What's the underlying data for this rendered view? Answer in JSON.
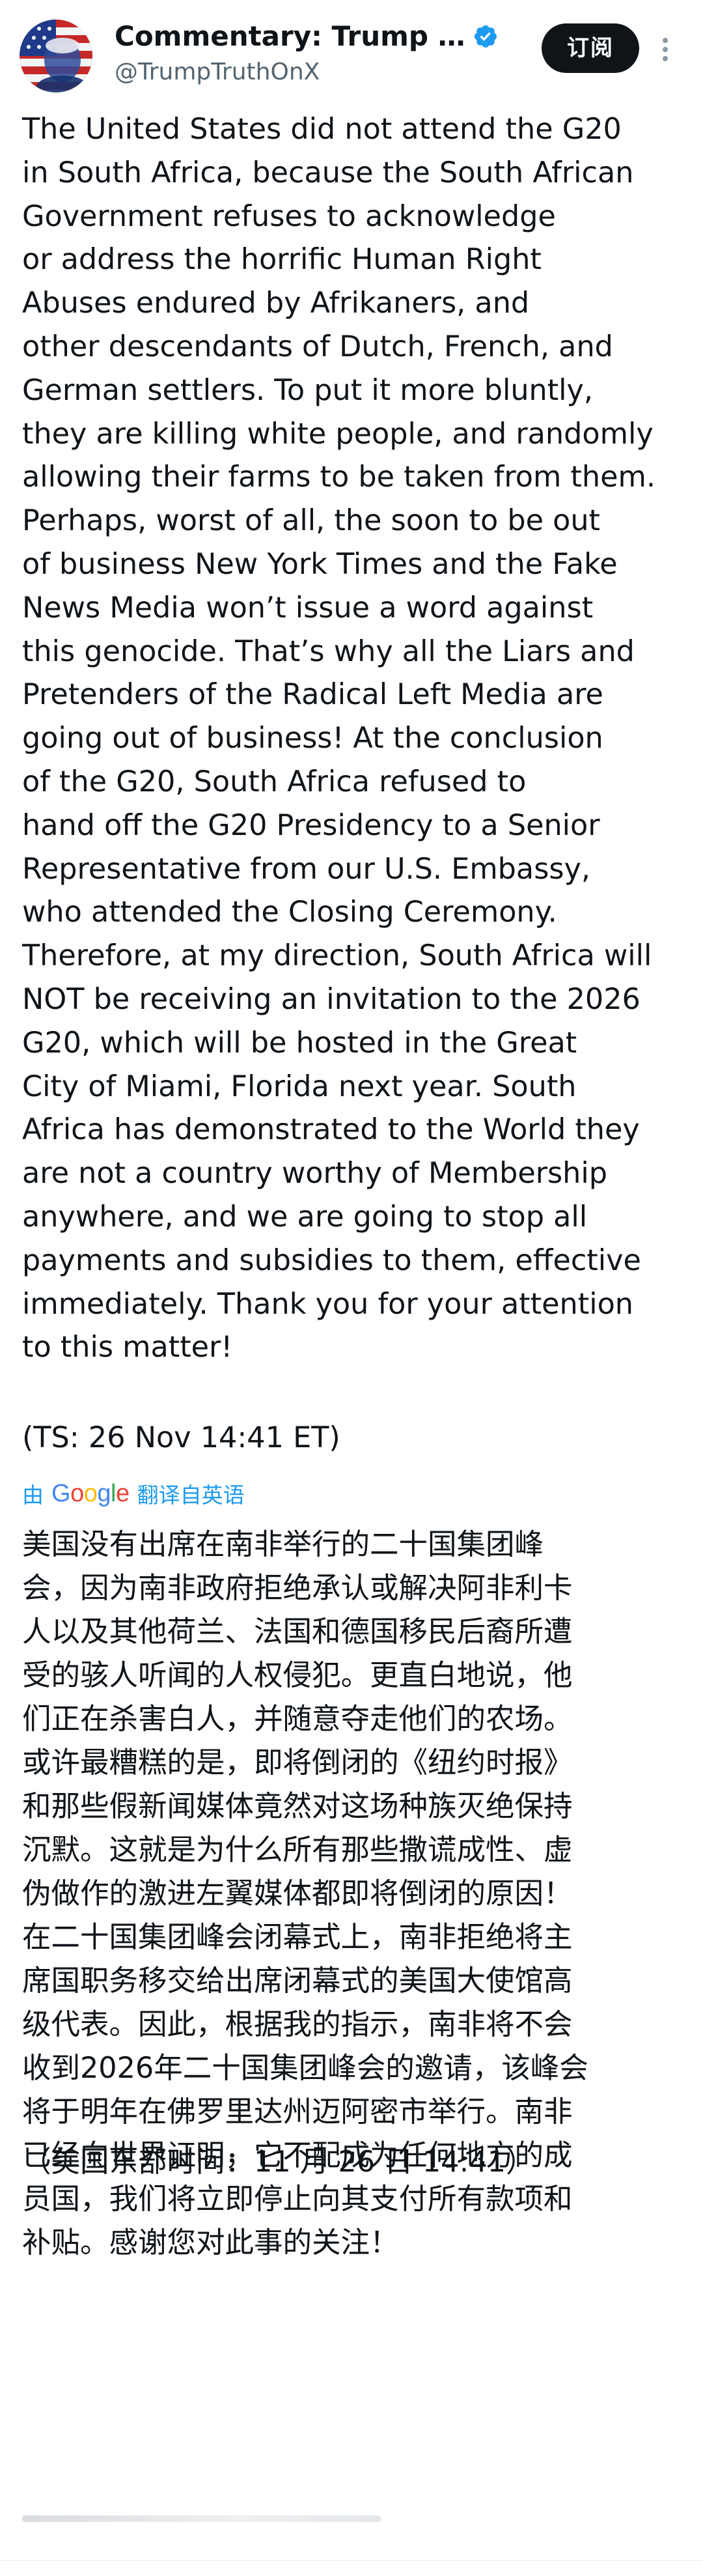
{
  "author": {
    "display_name": "Commentary: Trump Trut…",
    "handle": "@TrumpTruthOnX",
    "verified": true,
    "avatar_icon": "american-flag-portrait-avatar"
  },
  "actions": {
    "subscribe_label": "订阅",
    "more_icon": "more-vertical-icon"
  },
  "post": {
    "text": "The United States did not attend the G20\nin South Africa, because the South African\nGovernment refuses to acknowledge\nor address the horrific Human Right\nAbuses endured by Afrikaners, and\nother descendants of Dutch, French, and\nGerman settlers. To put it more bluntly,\nthey are killing white people, and randomly\nallowing their farms to be taken from them.\nPerhaps, worst of all, the soon to be out\nof business New York Times and the Fake\nNews Media won’t issue a word against\nthis genocide. That’s why all the Liars and\nPretenders of the Radical Left Media are\ngoing out of business! At the conclusion\nof the G20, South Africa refused to\nhand off the G20 Presidency to a Senior\nRepresentative from our U.S. Embassy,\nwho attended the Closing Ceremony.\nTherefore, at my direction, South Africa will\nNOT be receiving an invitation to the 2026\nG20, which will be hosted in the Great\nCity of Miami, Florida next year. South\nAfrica has demonstrated to the World they\nare not a country worthy of Membership\nanywhere, and we are going to stop all\npayments and subsidies to them, effective\nimmediately. Thank you for your attention\nto this matter!",
    "timestamp": "(TS: 26 Nov 14:41 ET)"
  },
  "translation": {
    "prefix": "由",
    "provider": "Google",
    "label": "翻译自英语",
    "text": "美国没有出席在南非举行的二十国集团峰\n会，因为南非政府拒绝承认或解决阿非利卡\n人以及其他荷兰、法国和德国移民后裔所遭\n受的骇人听闻的人权侵犯。更直白地说，他\n们正在杀害白人，并随意夺走他们的农场。\n或许最糟糕的是，即将倒闭的《纽约时报》\n和那些假新闻媒体竟然对这场种族灭绝保持\n沉默。这就是为什么所有那些撒谎成性、虚\n伪做作的激进左翼媒体都即将倒闭的原因！\n在二十国集团峰会闭幕式上，南非拒绝将主\n席国职务移交给出席闭幕式的美国大使馆高\n级代表。因此，根据我的指示，南非将不会\n收到2026年二十国集团峰会的邀请，该峰会\n将于明年在佛罗里达州迈阿密市举行。南非\n已经向世界证明，它不配成为任何地方的成\n员国，我们将立即停止向其支付所有款项和\n补贴。感谢您对此事的关注！",
    "timestamp": "（美国东部时间：11 月 26 日 14:41）"
  },
  "colors": {
    "text": "#0f1419",
    "secondary": "#536471",
    "accent": "#1d9bf0",
    "button_bg": "#0f1419"
  }
}
